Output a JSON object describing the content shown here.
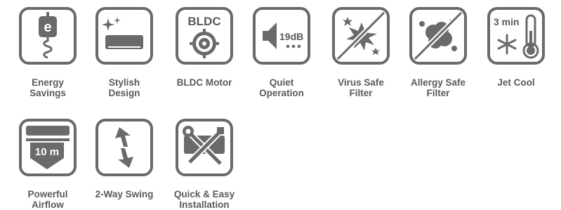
{
  "features": [
    {
      "id": "energy",
      "icon": "energy-plug-icon",
      "label": "Energy\nSavings",
      "badge": "e"
    },
    {
      "id": "stylish",
      "icon": "stylish-ac-icon",
      "label": "Stylish\nDesign"
    },
    {
      "id": "bldc",
      "icon": "bldc-motor-icon",
      "label": "BLDC Motor",
      "badge": "BLDC"
    },
    {
      "id": "quiet",
      "icon": "quiet-speaker-icon",
      "label": "Quiet\nOperation",
      "badge": "19dB"
    },
    {
      "id": "virus",
      "icon": "virus-filter-icon",
      "label": "Virus Safe\nFilter"
    },
    {
      "id": "allergy",
      "icon": "allergy-filter-icon",
      "label": "Allergy Safe\nFilter"
    },
    {
      "id": "jetcool",
      "icon": "jet-cool-thermometer-icon",
      "label": "Jet Cool",
      "badge": "3 min"
    },
    {
      "id": "airflow",
      "icon": "powerful-airflow-icon",
      "label": "Powerful\nAirflow",
      "badge": "10 m"
    },
    {
      "id": "swing",
      "icon": "two-way-swing-icon",
      "label": "2-Way Swing"
    },
    {
      "id": "install",
      "icon": "installation-tools-icon",
      "label": "Quick & Easy\nInstallation"
    }
  ]
}
